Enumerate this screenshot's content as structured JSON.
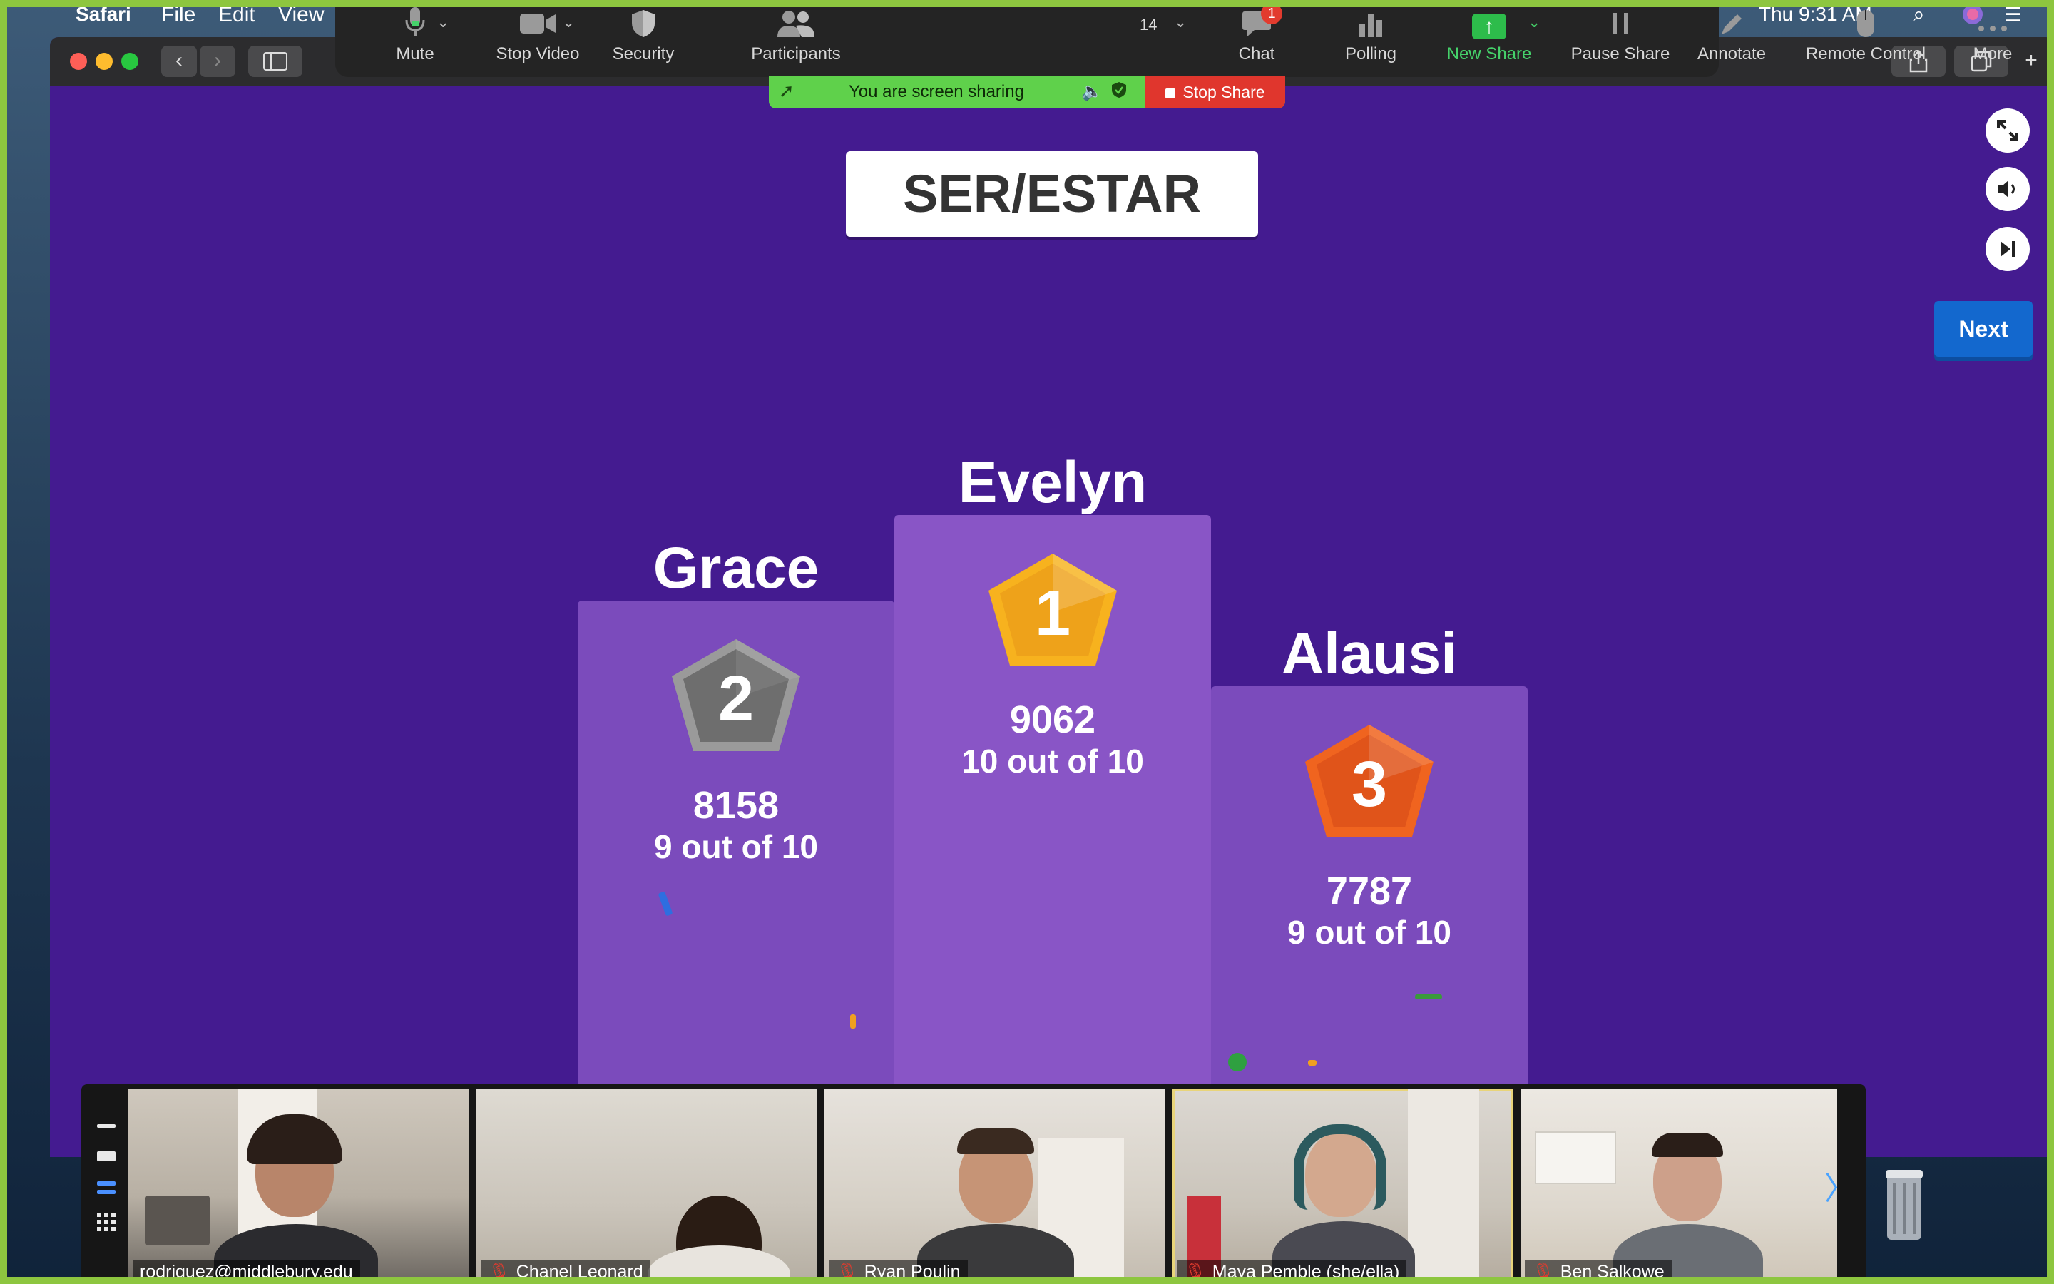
{
  "menubar": {
    "app": "Safari",
    "menus": [
      "File",
      "Edit",
      "View"
    ],
    "clock": "Thu 9:31 AM"
  },
  "zoom_toolbar": {
    "mute": "Mute",
    "stop_video": "Stop Video",
    "security": "Security",
    "participants": "Participants",
    "participant_count": "14",
    "chat": "Chat",
    "chat_badge": "1",
    "polling": "Polling",
    "new_share": "New Share",
    "pause_share": "Pause Share",
    "annotate": "Annotate",
    "remote_control": "Remote Control",
    "more": "More"
  },
  "share_banner": {
    "text": "You are screen sharing",
    "stop_label": "Stop Share"
  },
  "game": {
    "title": "SER/ESTAR",
    "next_label": "Next",
    "podium": [
      {
        "place": "2",
        "name": "Grace",
        "score": "8158",
        "correct": "9 out of 10"
      },
      {
        "place": "1",
        "name": "Evelyn",
        "score": "9062",
        "correct": "10 out of 10"
      },
      {
        "place": "3",
        "name": "Alausi",
        "score": "7787",
        "correct": "9 out of 10"
      }
    ]
  },
  "participants_strip": [
    {
      "name": "rodriguez@middlebury.edu",
      "muted": false
    },
    {
      "name": "Chanel Leonard",
      "muted": true
    },
    {
      "name": "Ryan Poulin",
      "muted": true
    },
    {
      "name": "Maya Pemble (she/ella)",
      "muted": true
    },
    {
      "name": "Ben Salkowe",
      "muted": true
    }
  ],
  "colors": {
    "share_green": "#5fd14b",
    "stop_red": "#e0362d",
    "kahoot_purple": "#441b90",
    "podium_purple": "#7b4bbc",
    "next_blue": "#1368ce",
    "gold": "#f0a020",
    "silver": "#8a8a8a",
    "bronze": "#e85a1a"
  }
}
